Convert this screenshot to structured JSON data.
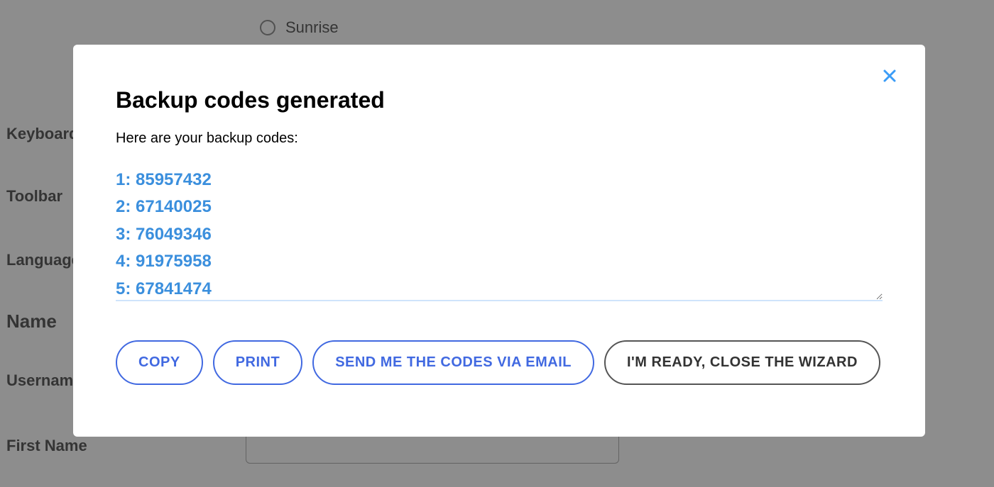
{
  "background": {
    "radio_option": "Sunrise",
    "labels": {
      "keyboard": "Keyboard",
      "toolbar": "Toolbar",
      "language": "Language",
      "username": "Username",
      "firstname": "First Name"
    },
    "heading_name": "Name"
  },
  "modal": {
    "title": "Backup codes generated",
    "subtitle": "Here are your backup codes:",
    "codes": [
      "1: 85957432",
      "2: 67140025",
      "3: 76049346",
      "4: 91975958",
      "5: 67841474"
    ],
    "buttons": {
      "copy": "COPY",
      "print": "PRINT",
      "email": "SEND ME THE CODES VIA EMAIL",
      "close": "I'M READY, CLOSE THE WIZARD"
    }
  }
}
